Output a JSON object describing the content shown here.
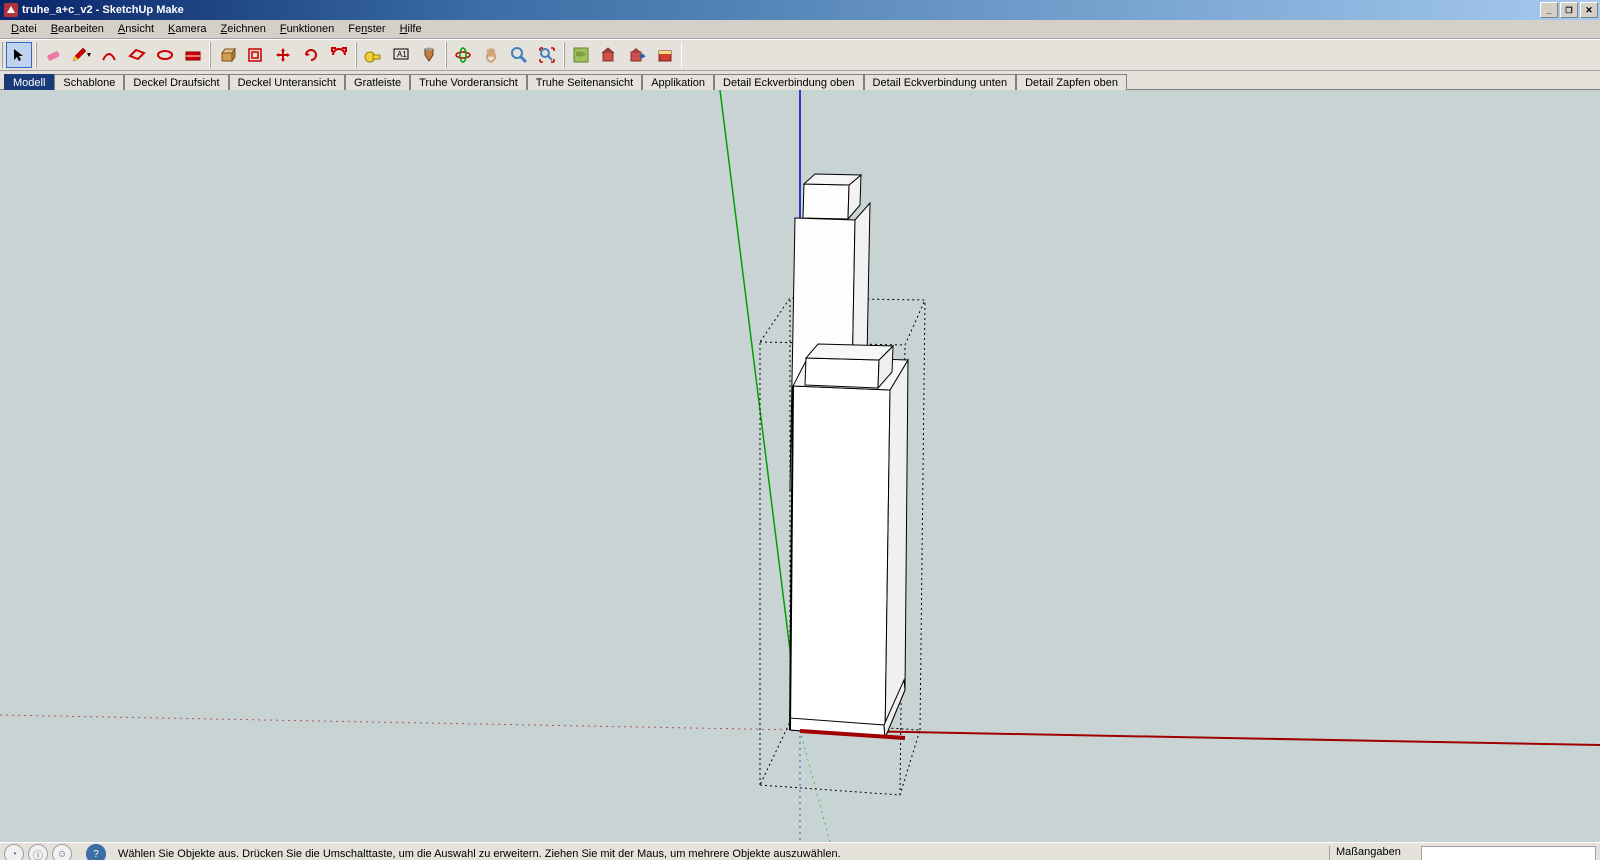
{
  "window": {
    "title": "truhe_a+c_v2 - SketchUp Make"
  },
  "menu": {
    "items": [
      "Datei",
      "Bearbeiten",
      "Ansicht",
      "Kamera",
      "Zeichnen",
      "Funktionen",
      "Fenster",
      "Hilfe"
    ]
  },
  "toolbar": {
    "icons": [
      {
        "name": "select-icon",
        "sel": true
      },
      {
        "name": "eraser-icon"
      },
      {
        "name": "pencil-icon"
      },
      {
        "name": "arc-icon"
      },
      {
        "name": "rectangle-icon"
      },
      {
        "name": "circle-icon"
      },
      {
        "name": "polygon-icon"
      },
      {
        "name": "pushpull-icon"
      },
      {
        "name": "offset-icon"
      },
      {
        "name": "move-icon"
      },
      {
        "name": "rotate-icon"
      },
      {
        "name": "scale-icon"
      },
      {
        "name": "tape-icon"
      },
      {
        "name": "text-icon"
      },
      {
        "name": "paint-icon"
      },
      {
        "name": "orbit-icon"
      },
      {
        "name": "pan-icon"
      },
      {
        "name": "zoom-icon"
      },
      {
        "name": "zoom-extents-icon"
      },
      {
        "name": "add-location-icon"
      },
      {
        "name": "get-model-icon"
      },
      {
        "name": "share-model-icon"
      },
      {
        "name": "extension-icon"
      }
    ]
  },
  "scenes": {
    "tabs": [
      {
        "label": "Modell",
        "active": true
      },
      {
        "label": "Schablone"
      },
      {
        "label": "Deckel Draufsicht"
      },
      {
        "label": "Deckel Unteransicht"
      },
      {
        "label": "Gratleiste"
      },
      {
        "label": "Truhe Vorderansicht"
      },
      {
        "label": "Truhe Seitenansicht"
      },
      {
        "label": "Applikation"
      },
      {
        "label": "Detail Eckverbindung oben"
      },
      {
        "label": "Detail Eckverbindung unten"
      },
      {
        "label": "Detail Zapfen oben"
      }
    ]
  },
  "status": {
    "hint": "Wählen Sie Objekte aus. Drücken Sie die Umschalttaste, um die Auswahl zu erweitern. Ziehen Sie mit der Maus, um mehrere Objekte auszuwählen.",
    "measurements_label": "Maßangaben"
  },
  "viewport": {
    "background": "#c8d4d4",
    "axes": {
      "red": "#a00000",
      "green": "#00a000",
      "blue": "#0000c0"
    }
  }
}
